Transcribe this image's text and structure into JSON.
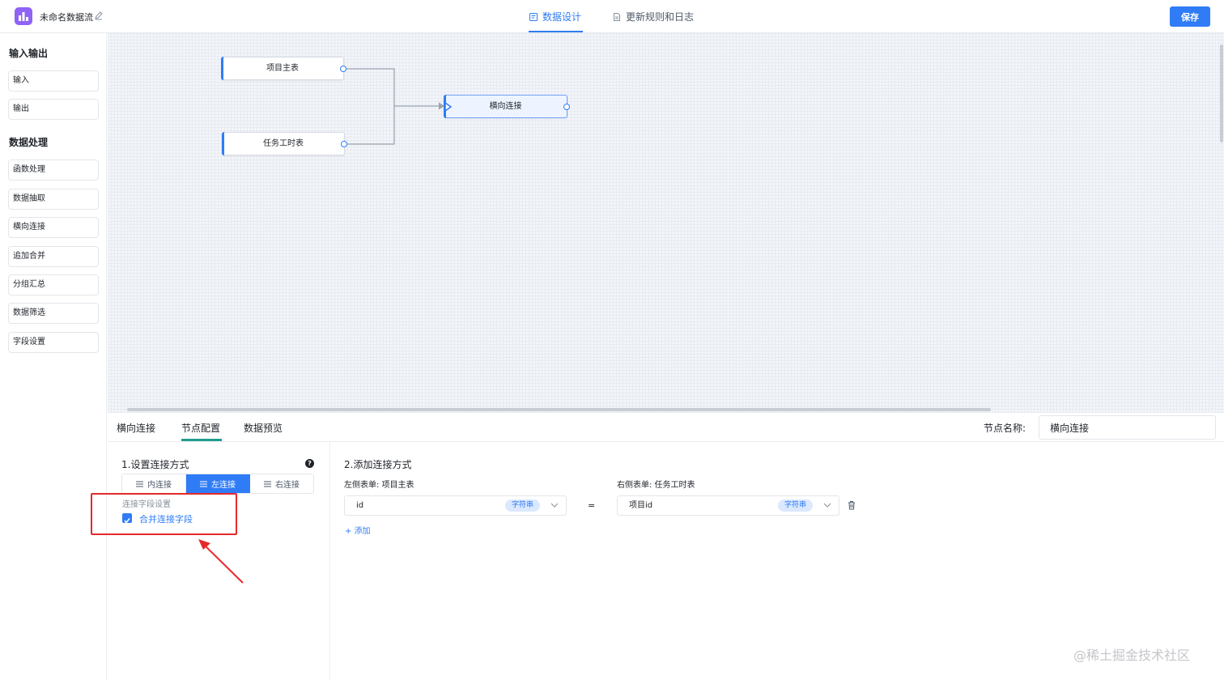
{
  "header": {
    "app_title": "未命名数据流",
    "tabs": [
      {
        "label": "数据设计",
        "active": true
      },
      {
        "label": "更新规则和日志",
        "active": false
      }
    ],
    "save_label": "保存",
    "accent_color": "#2f7cf6"
  },
  "sidebar": {
    "sections": [
      {
        "title": "输入输出",
        "items": [
          "输入",
          "输出"
        ]
      },
      {
        "title": "数据处理",
        "items": [
          "函数处理",
          "数据抽取",
          "横向连接",
          "追加合并",
          "分组汇总",
          "数据筛选",
          "字段设置"
        ]
      }
    ]
  },
  "canvas": {
    "nodes": [
      {
        "label": "项目主表"
      },
      {
        "label": "任务工时表"
      },
      {
        "label": "横向连接",
        "selected": true
      }
    ]
  },
  "bottom": {
    "tabs": [
      "横向连接",
      "节点配置",
      "数据预览"
    ],
    "active_tab": "节点配置",
    "node_name_label": "节点名称:",
    "node_name_value": "横向连接"
  },
  "config": {
    "section1_title": "1.设置连接方式",
    "help_icon": "?",
    "join_types": [
      {
        "label": "内连接",
        "active": false
      },
      {
        "label": "左连接",
        "active": true
      },
      {
        "label": "右连接",
        "active": false
      }
    ],
    "field_settings_label": "连接字段设置",
    "merge_fields_label": "合并连接字段",
    "merge_fields_checked": true,
    "section2_title": "2.添加连接方式",
    "left_table_label": "左侧表单:  项目主表",
    "right_table_label": "右侧表单:  任务工时表",
    "equals": "=",
    "left_field": {
      "value": "id",
      "type": "字符串"
    },
    "right_field": {
      "value": "项目id",
      "type": "字符串"
    },
    "add_label": "添加"
  },
  "watermark": "@稀土掘金技术社区"
}
